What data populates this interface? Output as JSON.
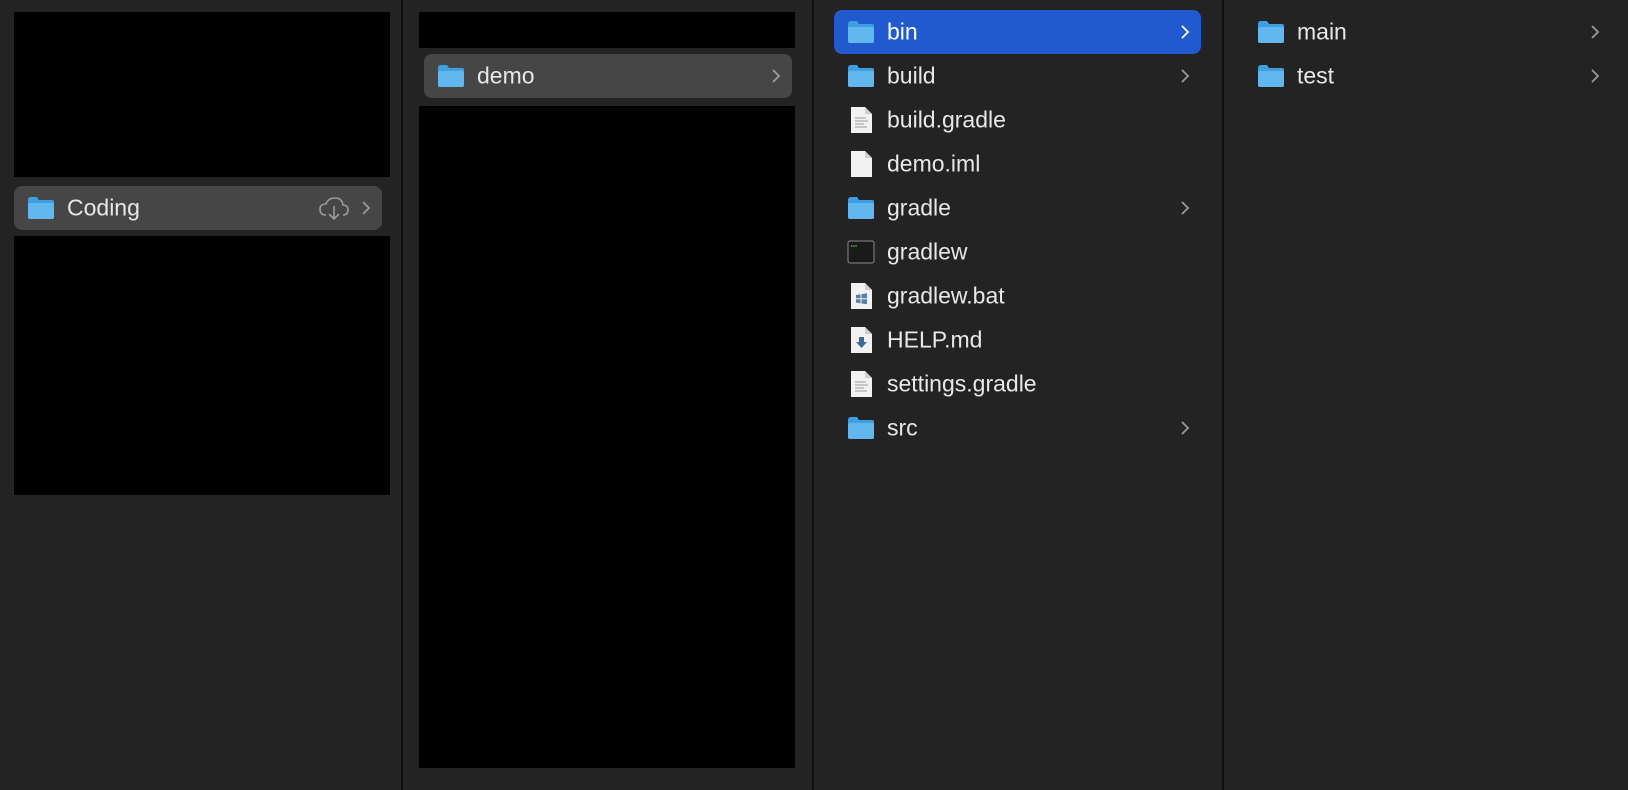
{
  "columns": [
    {
      "items": [
        {
          "name": "Coding",
          "kind": "folder",
          "icon": "folder-icon",
          "cloud": "cloud-download-icon",
          "selected": "gray"
        }
      ]
    },
    {
      "items": [
        {
          "name": "demo",
          "kind": "folder",
          "icon": "folder-icon",
          "selected": "gray"
        }
      ]
    },
    {
      "items": [
        {
          "name": "bin",
          "kind": "folder",
          "icon": "folder-icon",
          "selected": "blue"
        },
        {
          "name": "build",
          "kind": "folder",
          "icon": "folder-icon"
        },
        {
          "name": "build.gradle",
          "kind": "document",
          "icon": "text-document-icon"
        },
        {
          "name": "demo.iml",
          "kind": "document",
          "icon": "blank-document-icon"
        },
        {
          "name": "gradle",
          "kind": "folder",
          "icon": "folder-icon"
        },
        {
          "name": "gradlew",
          "kind": "executable",
          "icon": "terminal-executable-icon"
        },
        {
          "name": "gradlew.bat",
          "kind": "document",
          "icon": "windows-batch-icon"
        },
        {
          "name": "HELP.md",
          "kind": "document",
          "icon": "markdown-download-icon"
        },
        {
          "name": "settings.gradle",
          "kind": "document",
          "icon": "text-document-icon"
        },
        {
          "name": "src",
          "kind": "folder",
          "icon": "folder-icon"
        }
      ]
    },
    {
      "items": [
        {
          "name": "main",
          "kind": "folder",
          "icon": "folder-icon"
        },
        {
          "name": "test",
          "kind": "folder",
          "icon": "folder-icon"
        }
      ]
    }
  ],
  "colors": {
    "background": "#232323",
    "selection_blue": "#2159cf",
    "selection_gray": "#464646",
    "folder_blue": "#5db3ea"
  }
}
